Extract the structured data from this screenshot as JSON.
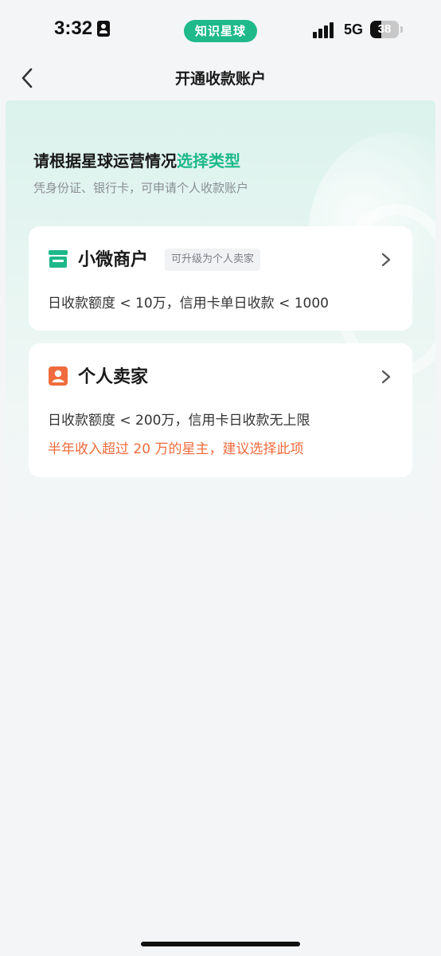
{
  "status_bar": {
    "time": "3:32",
    "app_label": "知识星球",
    "network": "5G",
    "battery_level": "38",
    "battery_percent": 38,
    "accent_color": "#1fb98a"
  },
  "nav": {
    "title": "开通收款账户",
    "back_icon": "chevron-left-icon"
  },
  "header": {
    "headline_prefix": "请根据星球运营情况",
    "headline_highlight": "选择类型",
    "subtitle": "凭身份证、银行卡，可申请个人收款账户",
    "highlight_color": "#1db88a"
  },
  "options": [
    {
      "icon": "store-icon",
      "title": "小微商户",
      "tag": "可升级为个人卖家",
      "description": "日收款额度 < 10万，信用卡单日收款 < 1000"
    },
    {
      "icon": "person-card-icon",
      "title": "个人卖家",
      "description": "日收款额度 < 200万，信用卡日收款无上限",
      "note": "半年收入超过 20 万的星主，建议选择此项",
      "note_color": "#f06b3d"
    }
  ]
}
